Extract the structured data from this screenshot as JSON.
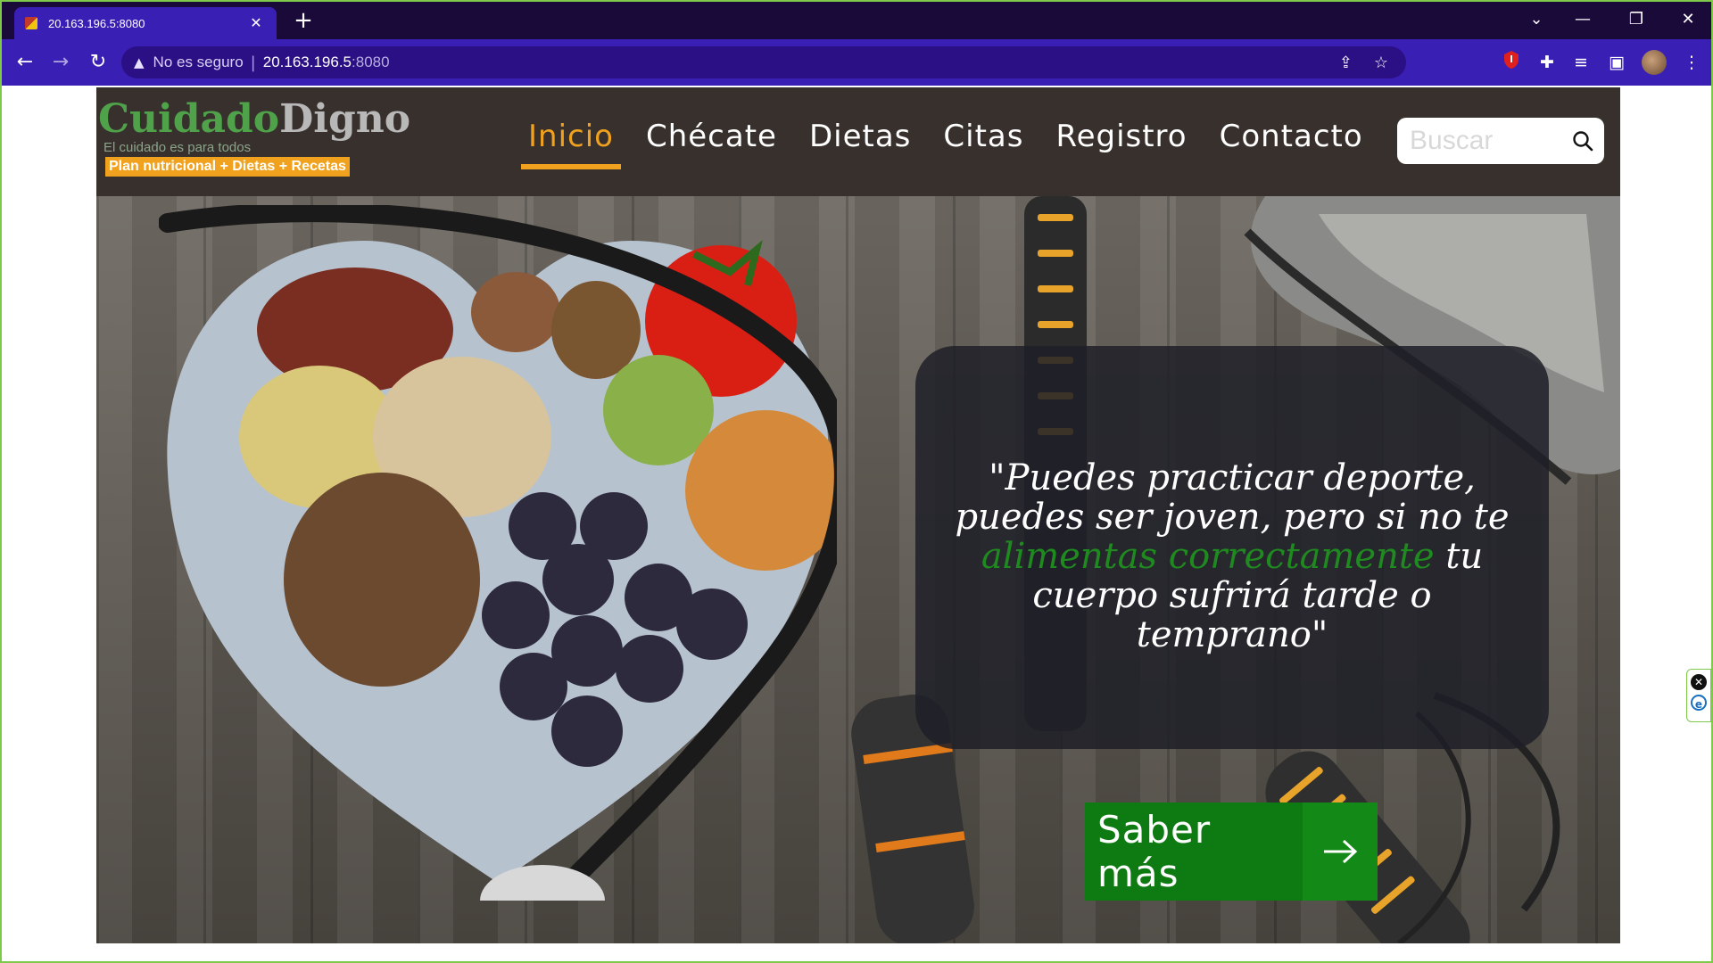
{
  "browser": {
    "tab_title": "20.163.196.5:8080",
    "tab_close": "✕",
    "new_tab": "+",
    "insecure_label": "No es seguro",
    "url_host": "20.163.196.5",
    "url_port": ":8080",
    "window_controls": {
      "list": "⌄",
      "minimize": "—",
      "restore": "❐",
      "close": "✕"
    },
    "nav": {
      "back": "←",
      "forward": "→",
      "reload": "↻"
    }
  },
  "site": {
    "logo": {
      "part1": "Cuidado",
      "part2": "Digno"
    },
    "tagline": "El cuidado es para todos",
    "promo": "Plan nutricional + Dietas + Recetas",
    "nav": [
      {
        "label": "Inicio"
      },
      {
        "label": "Chécate"
      },
      {
        "label": "Dietas"
      },
      {
        "label": "Citas"
      },
      {
        "label": "Registro"
      },
      {
        "label": "Contacto"
      }
    ],
    "search": {
      "placeholder": "Buscar"
    },
    "hero": {
      "quote_part1": "\"Puedes practicar deporte, puedes ser joven, pero si no te ",
      "quote_highlight": "alimentas correctamente",
      "quote_part2": " tu cuerpo sufrirá tarde o temprano\"",
      "cta_label": "Saber más"
    }
  },
  "colors": {
    "chrome_dark": "#1a0a3a",
    "chrome_toolbar": "#3a1fb5",
    "header_bg": "#38302d",
    "accent_orange": "#f0a21e",
    "brand_green": "#4fa24a",
    "cta_green": "#0e7a12",
    "quote_highlight": "#1f8a1f"
  }
}
